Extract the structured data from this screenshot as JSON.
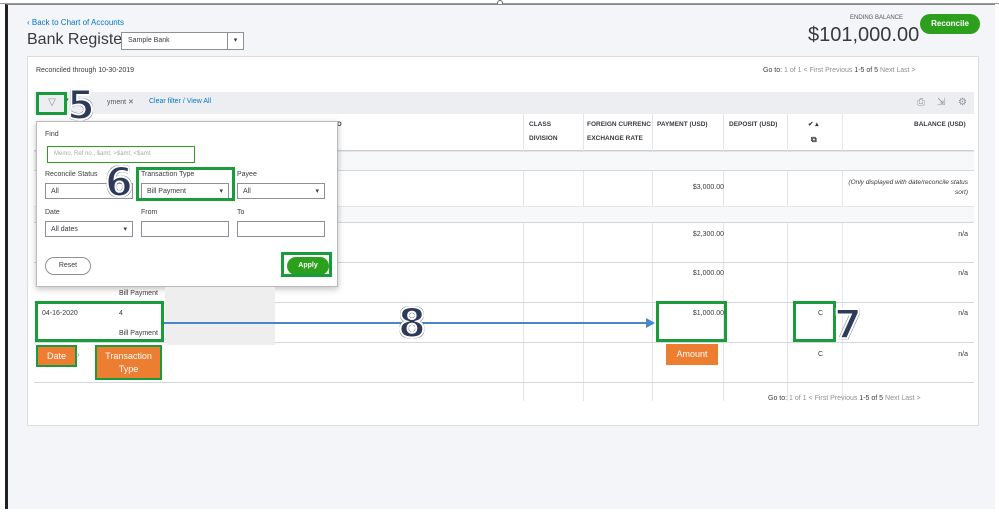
{
  "header": {
    "back_link": "Back to Chart of Accounts",
    "title": "Bank Register",
    "account": "Sample Bank",
    "ending_balance_label": "ENDING BALANCE",
    "ending_balance": "$101,000.00",
    "reconcile_label": "Reconcile"
  },
  "register": {
    "reconciled_through": "Reconciled through 10-30-2019",
    "pager_top": {
      "go_to": "Go to:",
      "page": "1",
      "of": "of 1",
      "first": "< First",
      "previous": "Previous",
      "range": "1-5 of 5",
      "next": "Next",
      "last": "Last >"
    },
    "pager_bottom": {
      "go_to": "Go to:",
      "page": "1",
      "of": "of 1",
      "first": "< First",
      "previous": "Previous",
      "range": "1-5 of 5",
      "next": "Next",
      "last": "Last >"
    },
    "filter_chip": "yment",
    "clear_filter": "Clear filter / View All",
    "columns": {
      "d": "D",
      "class": "CLASS",
      "division": "DIVISION",
      "fx": "FOREIGN CURRENC",
      "rate": "EXCHANGE RATE",
      "payment": "PAYMENT (USD)",
      "deposit": "DEPOSIT (USD)",
      "check": "✔ ▴",
      "balance": "BALANCE (USD)"
    },
    "rows": [
      {
        "payment": "$3,000.00",
        "balance": "(Only displayed with date/reconcile status sort)"
      },
      {
        "payment": "$2,300.00",
        "balance": "n/a"
      },
      {
        "payment": "$1,000.00",
        "balance": "n/a",
        "type": "Bill Payment"
      },
      {
        "date": "04-16-2020",
        "ref": "4",
        "type": "Bill Payment",
        "payment": "$1,000.00",
        "status": "C",
        "balance": "n/a"
      },
      {
        "status": "C",
        "balance": "n/a"
      }
    ]
  },
  "filter_popup": {
    "find_label": "Find",
    "find_placeholder": "Memo, Ref no., $amt, >$amt, <$amt",
    "reconcile_label": "Reconcile Status",
    "reconcile_value": "All",
    "type_label": "Transaction Type",
    "type_value": "Bill Payment",
    "payee_label": "Payee",
    "payee_value": "All",
    "date_label": "Date",
    "date_value": "All dates",
    "from_label": "From",
    "to_label": "To",
    "reset_label": "Reset",
    "apply_label": "Apply"
  },
  "annotations": {
    "n5": "5",
    "n6": "6",
    "n7": "7",
    "n8": "8",
    "date_badge": "Date",
    "type_badge": "Transaction Type",
    "amount_badge": "Amount",
    "box_color": "#1a9b3c",
    "badge_color": "#ed7d31"
  }
}
